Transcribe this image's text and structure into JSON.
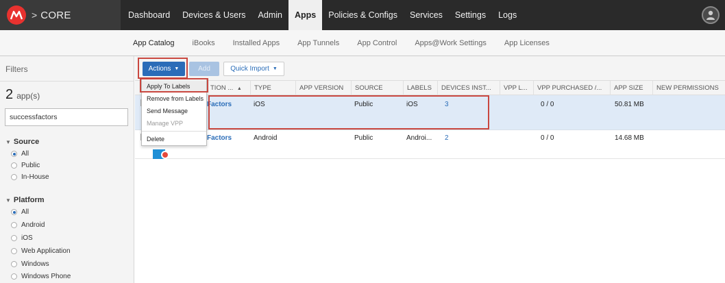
{
  "app": {
    "brand": "CORE",
    "separator": ">"
  },
  "topnav": {
    "items": [
      "Dashboard",
      "Devices & Users",
      "Admin",
      "Apps",
      "Policies & Configs",
      "Services",
      "Settings",
      "Logs"
    ],
    "active": "Apps"
  },
  "subnav": {
    "tabs": [
      "App Catalog",
      "iBooks",
      "Installed Apps",
      "App Tunnels",
      "App Control",
      "Apps@Work Settings",
      "App Licenses"
    ],
    "active": "App Catalog"
  },
  "sidebar": {
    "filters_title": "Filters",
    "count": "2",
    "count_label": "app(s)",
    "search_value": "successfactors",
    "source": {
      "title": "Source",
      "options": [
        "All",
        "Public",
        "In-House"
      ],
      "selected": "All"
    },
    "platform": {
      "title": "Platform",
      "options": [
        "All",
        "Android",
        "iOS",
        "Web Application",
        "Windows",
        "Windows Phone"
      ],
      "selected": "All"
    }
  },
  "toolbar": {
    "actions_label": "Actions",
    "add_label": "Add",
    "import_label": "Quick Import"
  },
  "actions_menu": {
    "items": [
      "Apply To Labels",
      "Remove from Labels",
      "Send Message",
      "Manage VPP",
      "Delete"
    ],
    "highlighted": "Apply To Labels",
    "disabled": [
      "Manage VPP"
    ]
  },
  "table": {
    "columns": [
      "TION ...",
      "TYPE",
      "APP VERSION",
      "SOURCE",
      "LABELS",
      "DEVICES INST...",
      "VPP L...",
      "VPP PURCHASED /...",
      "APP SIZE",
      "NEW PERMISSIONS"
    ],
    "sort_indicator": "▲",
    "rows": [
      {
        "name": "Factors",
        "type": "iOS",
        "version": "",
        "source": "Public",
        "labels": "iOS",
        "devices": "3",
        "vpp_l": "",
        "vpp_purchased": "0 / 0",
        "size": "50.81 MB",
        "permissions": ""
      },
      {
        "name": "Factors",
        "type": "Android",
        "version": "",
        "source": "Public",
        "labels": "Androi...",
        "devices": "2",
        "vpp_l": "",
        "vpp_purchased": "0 / 0",
        "size": "14.68 MB",
        "permissions": ""
      }
    ]
  },
  "colors": {
    "accent": "#2b6cb8",
    "highlight_box": "#c9473f",
    "selected_row": "#dfeaf7",
    "topbar": "#2a2a2a"
  },
  "icons": {
    "logo": "mobileiron-logo-icon",
    "user": "user-avatar-icon",
    "caret": "chevron-down-icon",
    "badge": "minus-badge-icon"
  }
}
